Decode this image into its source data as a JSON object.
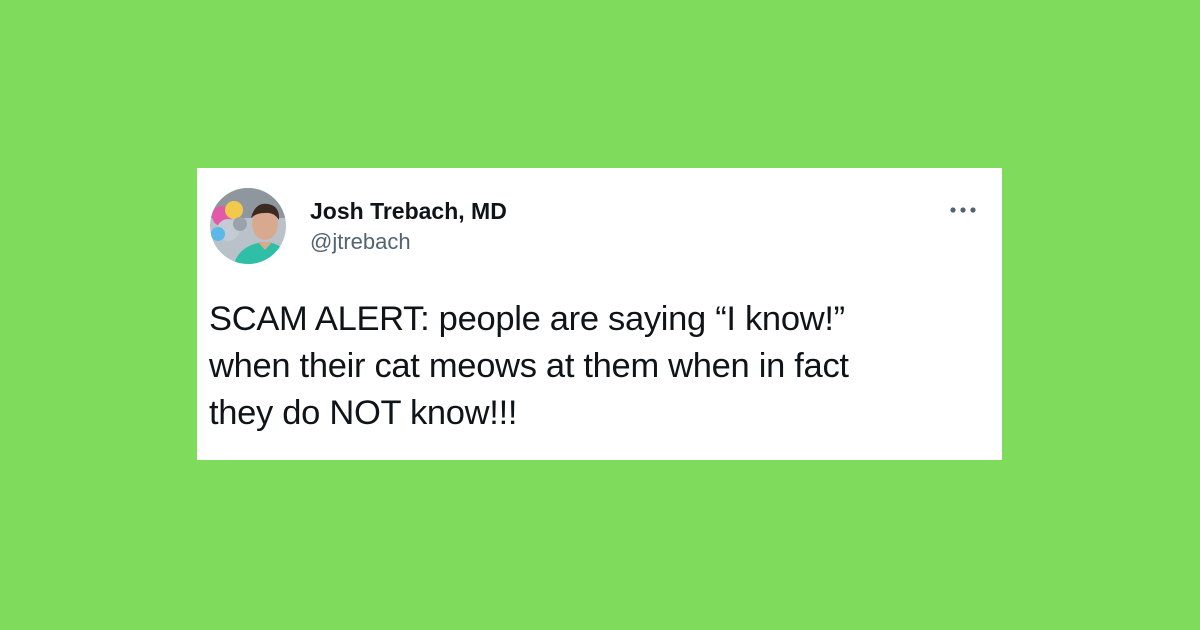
{
  "page": {
    "background_color": "#7FDB5B"
  },
  "tweet": {
    "author": {
      "display_name": "Josh Trebach, MD",
      "handle": "@jtrebach",
      "avatar_icon": "profile-photo"
    },
    "more_icon": "ellipsis-icon",
    "text_lines": [
      "SCAM ALERT: people are saying “I know!”",
      "when their cat meows at them when in fact",
      "they do NOT know!!!"
    ],
    "colors": {
      "card_background": "#FFFFFF",
      "primary_text": "#0F1419",
      "secondary_text": "#536471"
    }
  }
}
